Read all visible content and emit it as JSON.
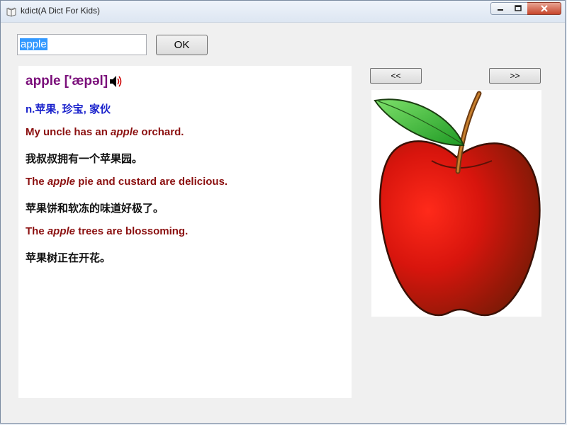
{
  "window": {
    "title": "kdict(A Dict For Kids)"
  },
  "search": {
    "value": "apple",
    "ok_label": "OK"
  },
  "entry": {
    "word": "apple",
    "phonetic": "['æpəl]",
    "meaning": "n.苹果, 珍宝, 家伙",
    "examples": [
      {
        "before": "My uncle has an ",
        "keyword": "apple",
        "after": " orchard.",
        "translation": "我叔叔拥有一个苹果园。"
      },
      {
        "before": "The ",
        "keyword": "apple",
        "after": " pie and custard are delicious.",
        "translation": "苹果饼和软冻的味道好极了。"
      },
      {
        "before": "The ",
        "keyword": "apple",
        "after": " trees are blossoming.",
        "translation": "苹果树正在开花。"
      }
    ]
  },
  "nav": {
    "prev_label": "<<",
    "next_label": ">>"
  },
  "image": {
    "subject": "apple-illustration"
  },
  "colors": {
    "word": "#7a0e7a",
    "meaning": "#1a22cc",
    "example_en": "#8b1010",
    "example_zh": "#111111",
    "selection": "#3399ff"
  }
}
